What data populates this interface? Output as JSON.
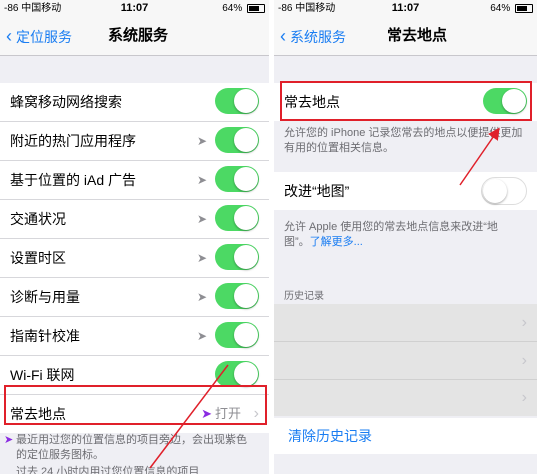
{
  "left": {
    "statusbar": {
      "carrier": "-86 中国移动",
      "time": "11:07",
      "battery": "64%"
    },
    "nav": {
      "back": "定位服务",
      "title": "系统服务"
    },
    "rows": [
      {
        "label": "蜂窝移动网络搜索",
        "toggle": true,
        "arrow": false
      },
      {
        "label": "附近的热门应用程序",
        "toggle": true,
        "arrow": true
      },
      {
        "label": "基于位置的 iAd 广告",
        "toggle": true,
        "arrow": true
      },
      {
        "label": "交通状况",
        "toggle": true,
        "arrow": true
      },
      {
        "label": "设置时区",
        "toggle": true,
        "arrow": true
      },
      {
        "label": "诊断与用量",
        "toggle": true,
        "arrow": true
      },
      {
        "label": "指南针校准",
        "toggle": true,
        "arrow": true
      },
      {
        "label": "Wi-Fi 联网",
        "toggle": true,
        "arrow": false
      },
      {
        "label": "常去地点",
        "value": "打开"
      }
    ],
    "footer1": "最近用过您的位置信息的项目旁边，会出现紫色的定位服务图标。",
    "footer2": "过去 24 小时内用过您位置信息的项目"
  },
  "right": {
    "statusbar": {
      "carrier": "-86 中国移动",
      "time": "11:07",
      "battery": "64%"
    },
    "nav": {
      "back": "系统服务",
      "title": "常去地点"
    },
    "row_main": {
      "label": "常去地点",
      "toggle": true
    },
    "desc1": "允许您的 iPhone 记录您常去的地点以便提供更加有用的位置相关信息。",
    "row_map": {
      "label": "改进“地图”",
      "toggle": false
    },
    "desc2": "允许 Apple 使用您的常去地点信息来改进“地图”。",
    "desc2_link": "了解更多...",
    "history_header": "历史记录",
    "clear_history": "清除历史记录"
  }
}
